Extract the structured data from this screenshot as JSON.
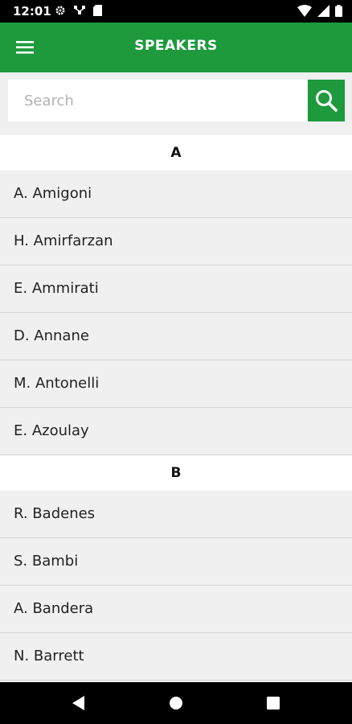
{
  "status_bar": {
    "time": "12:01",
    "left_icons": [
      "settings-icon",
      "network-icon",
      "sd-card-icon"
    ],
    "right_icons": [
      "wifi-icon",
      "signal-icon",
      "battery-icon"
    ]
  },
  "app_bar": {
    "title": "SPEAKERS",
    "menu_icon": "hamburger-menu-icon",
    "color": "#1e9a3d"
  },
  "search": {
    "placeholder": "Search",
    "value": "",
    "button_icon": "search-icon"
  },
  "sections": [
    {
      "letter": "A",
      "speakers": [
        "A. Amigoni",
        "H. Amirfarzan",
        "E. Ammirati",
        "D. Annane",
        "M. Antonelli",
        "E. Azoulay"
      ]
    },
    {
      "letter": "B",
      "speakers": [
        "R. Badenes",
        "S. Bambi",
        "A. Bandera",
        "N. Barrett"
      ]
    }
  ],
  "nav_bar": {
    "buttons": [
      "back-icon",
      "home-icon",
      "recents-icon"
    ]
  }
}
